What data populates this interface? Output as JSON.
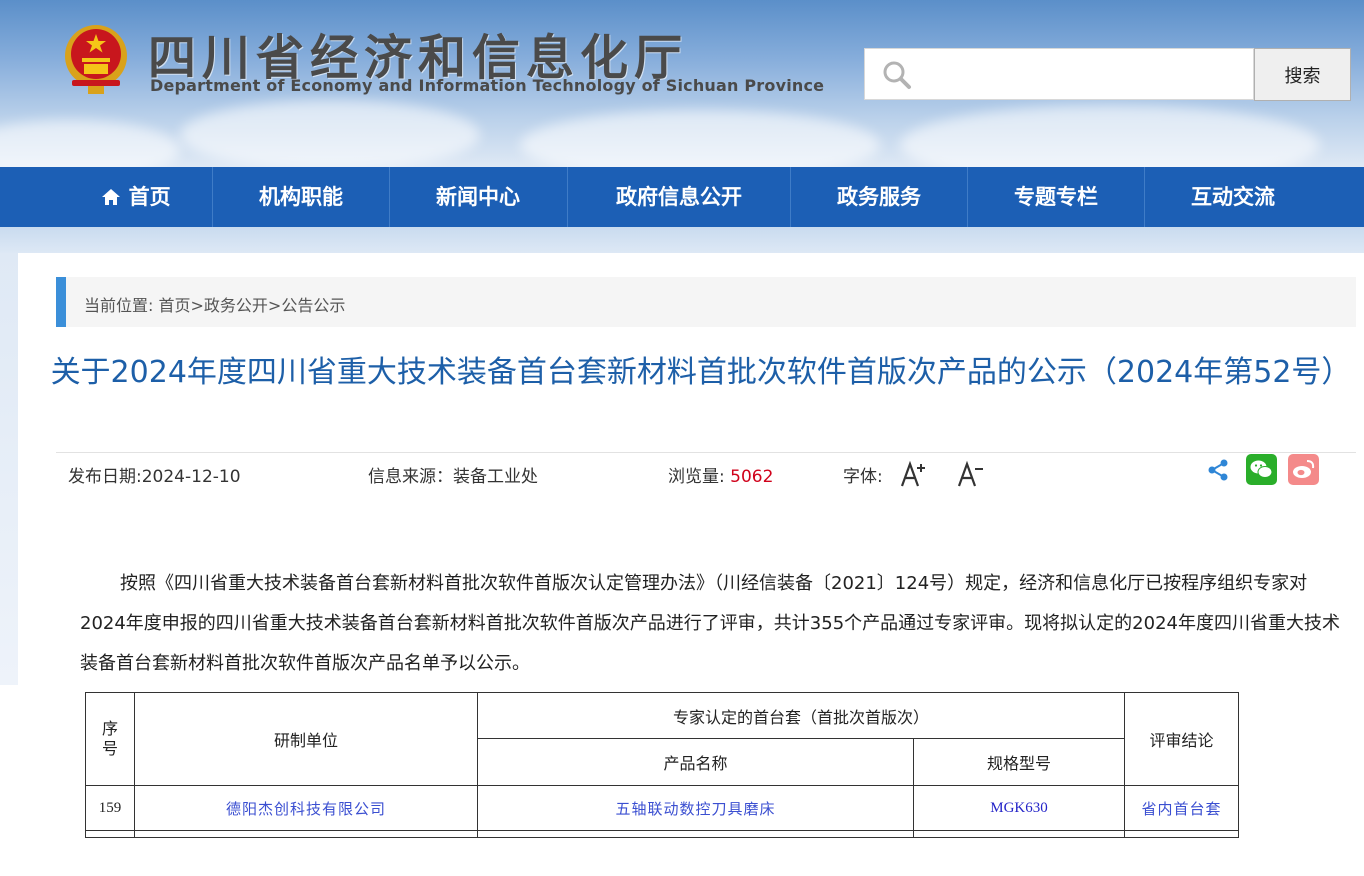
{
  "header": {
    "title_cn": "四川省经济和信息化厅",
    "title_en": "Department of Economy and Information Technology of Sichuan Province",
    "search_placeholder": "",
    "search_button": "搜索"
  },
  "nav": {
    "items": [
      {
        "label": "首页",
        "icon": "home-icon"
      },
      {
        "label": "机构职能"
      },
      {
        "label": "新闻中心"
      },
      {
        "label": "政府信息公开"
      },
      {
        "label": "政务服务"
      },
      {
        "label": "专题专栏"
      },
      {
        "label": "互动交流"
      }
    ]
  },
  "breadcrumb": {
    "prefix": "当前位置: ",
    "items": [
      "首页",
      "政务公开",
      "公告公示"
    ],
    "sep": ">"
  },
  "article": {
    "title": "关于2024年度四川省重大技术装备首台套新材料首批次软件首版次产品的公示（2024年第52号）",
    "publish_label": "发布日期:",
    "publish_date": "2024-12-10",
    "source_label": "信息来源：",
    "source": "装备工业处",
    "views_label": "浏览量: ",
    "views": "5062",
    "font_label": "字体:",
    "body": "按照《四川省重大技术装备首台套新材料首批次软件首版次认定管理办法》（川经信装备〔2021〕124号）规定，经济和信息化厅已按程序组织专家对2024年度申报的四川省重大技术装备首台套新材料首批次软件首版次产品进行了评审，共计355个产品通过专家评审。现将拟认定的2024年度四川省重大技术装备首台套新材料首批次软件首版次产品名单予以公示。"
  },
  "table": {
    "headers": {
      "seq": "序号",
      "org": "研制单位",
      "group": "专家认定的首台套（首批次首版次）",
      "product": "产品名称",
      "model": "规格型号",
      "result": "评审结论"
    },
    "rows": [
      {
        "seq": "159",
        "org": "德阳杰创科技有限公司",
        "product": "五轴联动数控刀具磨床",
        "model": "MGK630",
        "result": "省内首台套"
      }
    ]
  },
  "colors": {
    "nav_bg": "#1c5fb5",
    "title_blue": "#1d5fa8",
    "views_red": "#d0021b",
    "crumb_bar": "#3b8fd9"
  }
}
